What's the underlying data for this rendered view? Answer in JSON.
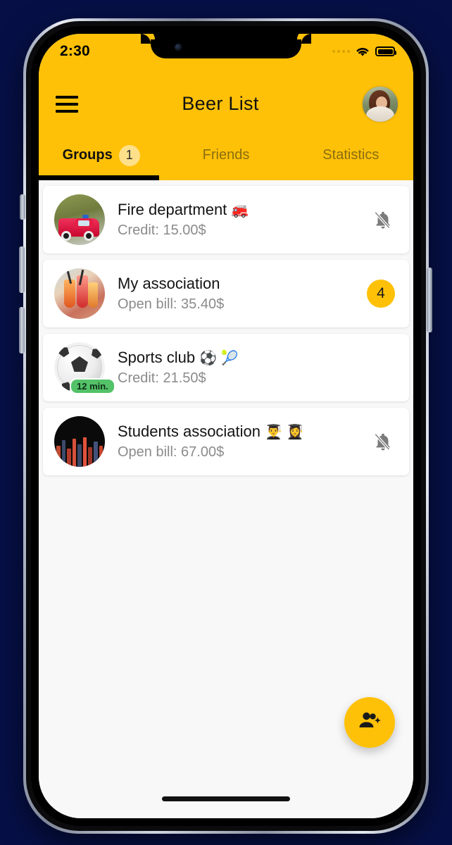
{
  "status_bar": {
    "time": "2:30",
    "signal_icon": "signal-dots-icon",
    "wifi_icon": "wifi-icon",
    "battery_icon": "battery-full-icon"
  },
  "app_bar": {
    "menu_icon": "hamburger-menu-icon",
    "title": "Beer List",
    "avatar_alt": "profile-avatar"
  },
  "tabs": [
    {
      "label": "Groups",
      "badge": "1",
      "active": true
    },
    {
      "label": "Friends",
      "badge": "",
      "active": false
    },
    {
      "label": "Statistics",
      "badge": "",
      "active": false
    }
  ],
  "groups": [
    {
      "title": "Fire department",
      "emoji": "🚒",
      "subtitle": "Credit: 15.00$",
      "trailing_type": "bell-off",
      "trailing_value": "",
      "thumb_badge": ""
    },
    {
      "title": "My association",
      "emoji": "",
      "subtitle": "Open bill: 35.40$",
      "trailing_type": "count",
      "trailing_value": "4",
      "thumb_badge": ""
    },
    {
      "title": "Sports club",
      "emoji": "⚽ 🎾",
      "subtitle": "Credit: 21.50$",
      "trailing_type": "none",
      "trailing_value": "",
      "thumb_badge": "12 min."
    },
    {
      "title": "Students association",
      "emoji": "👨‍🎓 👩‍🎓",
      "subtitle": "Open bill: 67.00$",
      "trailing_type": "bell-off",
      "trailing_value": "",
      "thumb_badge": ""
    }
  ],
  "fab": {
    "icon": "add-group-icon",
    "label": ""
  },
  "colors": {
    "brand_yellow": "#FFC107",
    "tab_badge_yellow": "#FFE08A",
    "screen_bg": "#F8F8F8",
    "card_bg": "#FFFFFF",
    "subtitle_gray": "#8B8B8B",
    "badge_green": "#53C268",
    "page_bg": "#061047"
  }
}
